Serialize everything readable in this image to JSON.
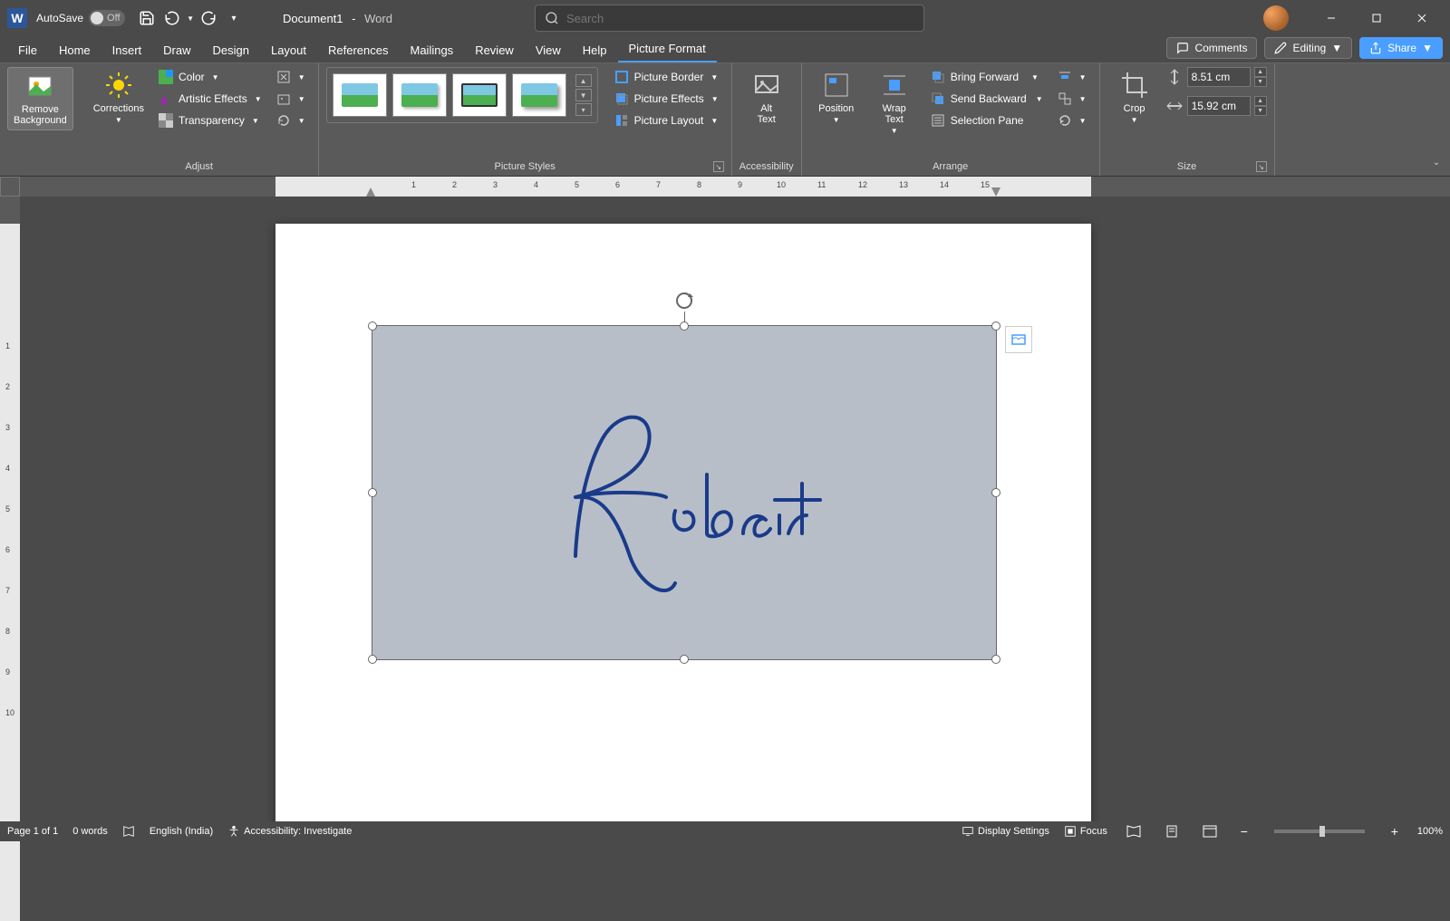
{
  "titlebar": {
    "autosave_label": "AutoSave",
    "autosave_state": "Off",
    "doc_name": "Document1",
    "separator": "-",
    "app_name": "Word",
    "search_placeholder": "Search"
  },
  "tabs": {
    "items": [
      "File",
      "Home",
      "Insert",
      "Draw",
      "Design",
      "Layout",
      "References",
      "Mailings",
      "Review",
      "View",
      "Help",
      "Picture Format"
    ],
    "active_index": 11,
    "comments_label": "Comments",
    "editing_label": "Editing",
    "share_label": "Share"
  },
  "ribbon": {
    "remove_bg": "Remove\nBackground",
    "corrections": "Corrections",
    "color": "Color",
    "artistic": "Artistic Effects",
    "transparency": "Transparency",
    "adjust_label": "Adjust",
    "styles_label": "Picture Styles",
    "picture_border": "Picture Border",
    "picture_effects": "Picture Effects",
    "picture_layout": "Picture Layout",
    "alt_text": "Alt\nText",
    "accessibility_label": "Accessibility",
    "position": "Position",
    "wrap_text": "Wrap\nText",
    "bring_forward": "Bring Forward",
    "send_backward": "Send Backward",
    "selection_pane": "Selection Pane",
    "arrange_label": "Arrange",
    "crop": "Crop",
    "height_value": "8.51 cm",
    "width_value": "15.92 cm",
    "size_label": "Size"
  },
  "ruler": {
    "h_marks": [
      "1",
      "2",
      "3",
      "4",
      "5",
      "6",
      "7",
      "8",
      "9",
      "10",
      "11",
      "12",
      "13",
      "14",
      "15"
    ],
    "v_marks": [
      "1",
      "2",
      "3",
      "4",
      "5",
      "6",
      "7",
      "8",
      "9",
      "10"
    ]
  },
  "document": {
    "signature_text": "Robert"
  },
  "statusbar": {
    "page_info": "Page 1 of 1",
    "word_count": "0 words",
    "language": "English (India)",
    "accessibility": "Accessibility: Investigate",
    "display_settings": "Display Settings",
    "focus": "Focus",
    "zoom_level": "100%"
  }
}
